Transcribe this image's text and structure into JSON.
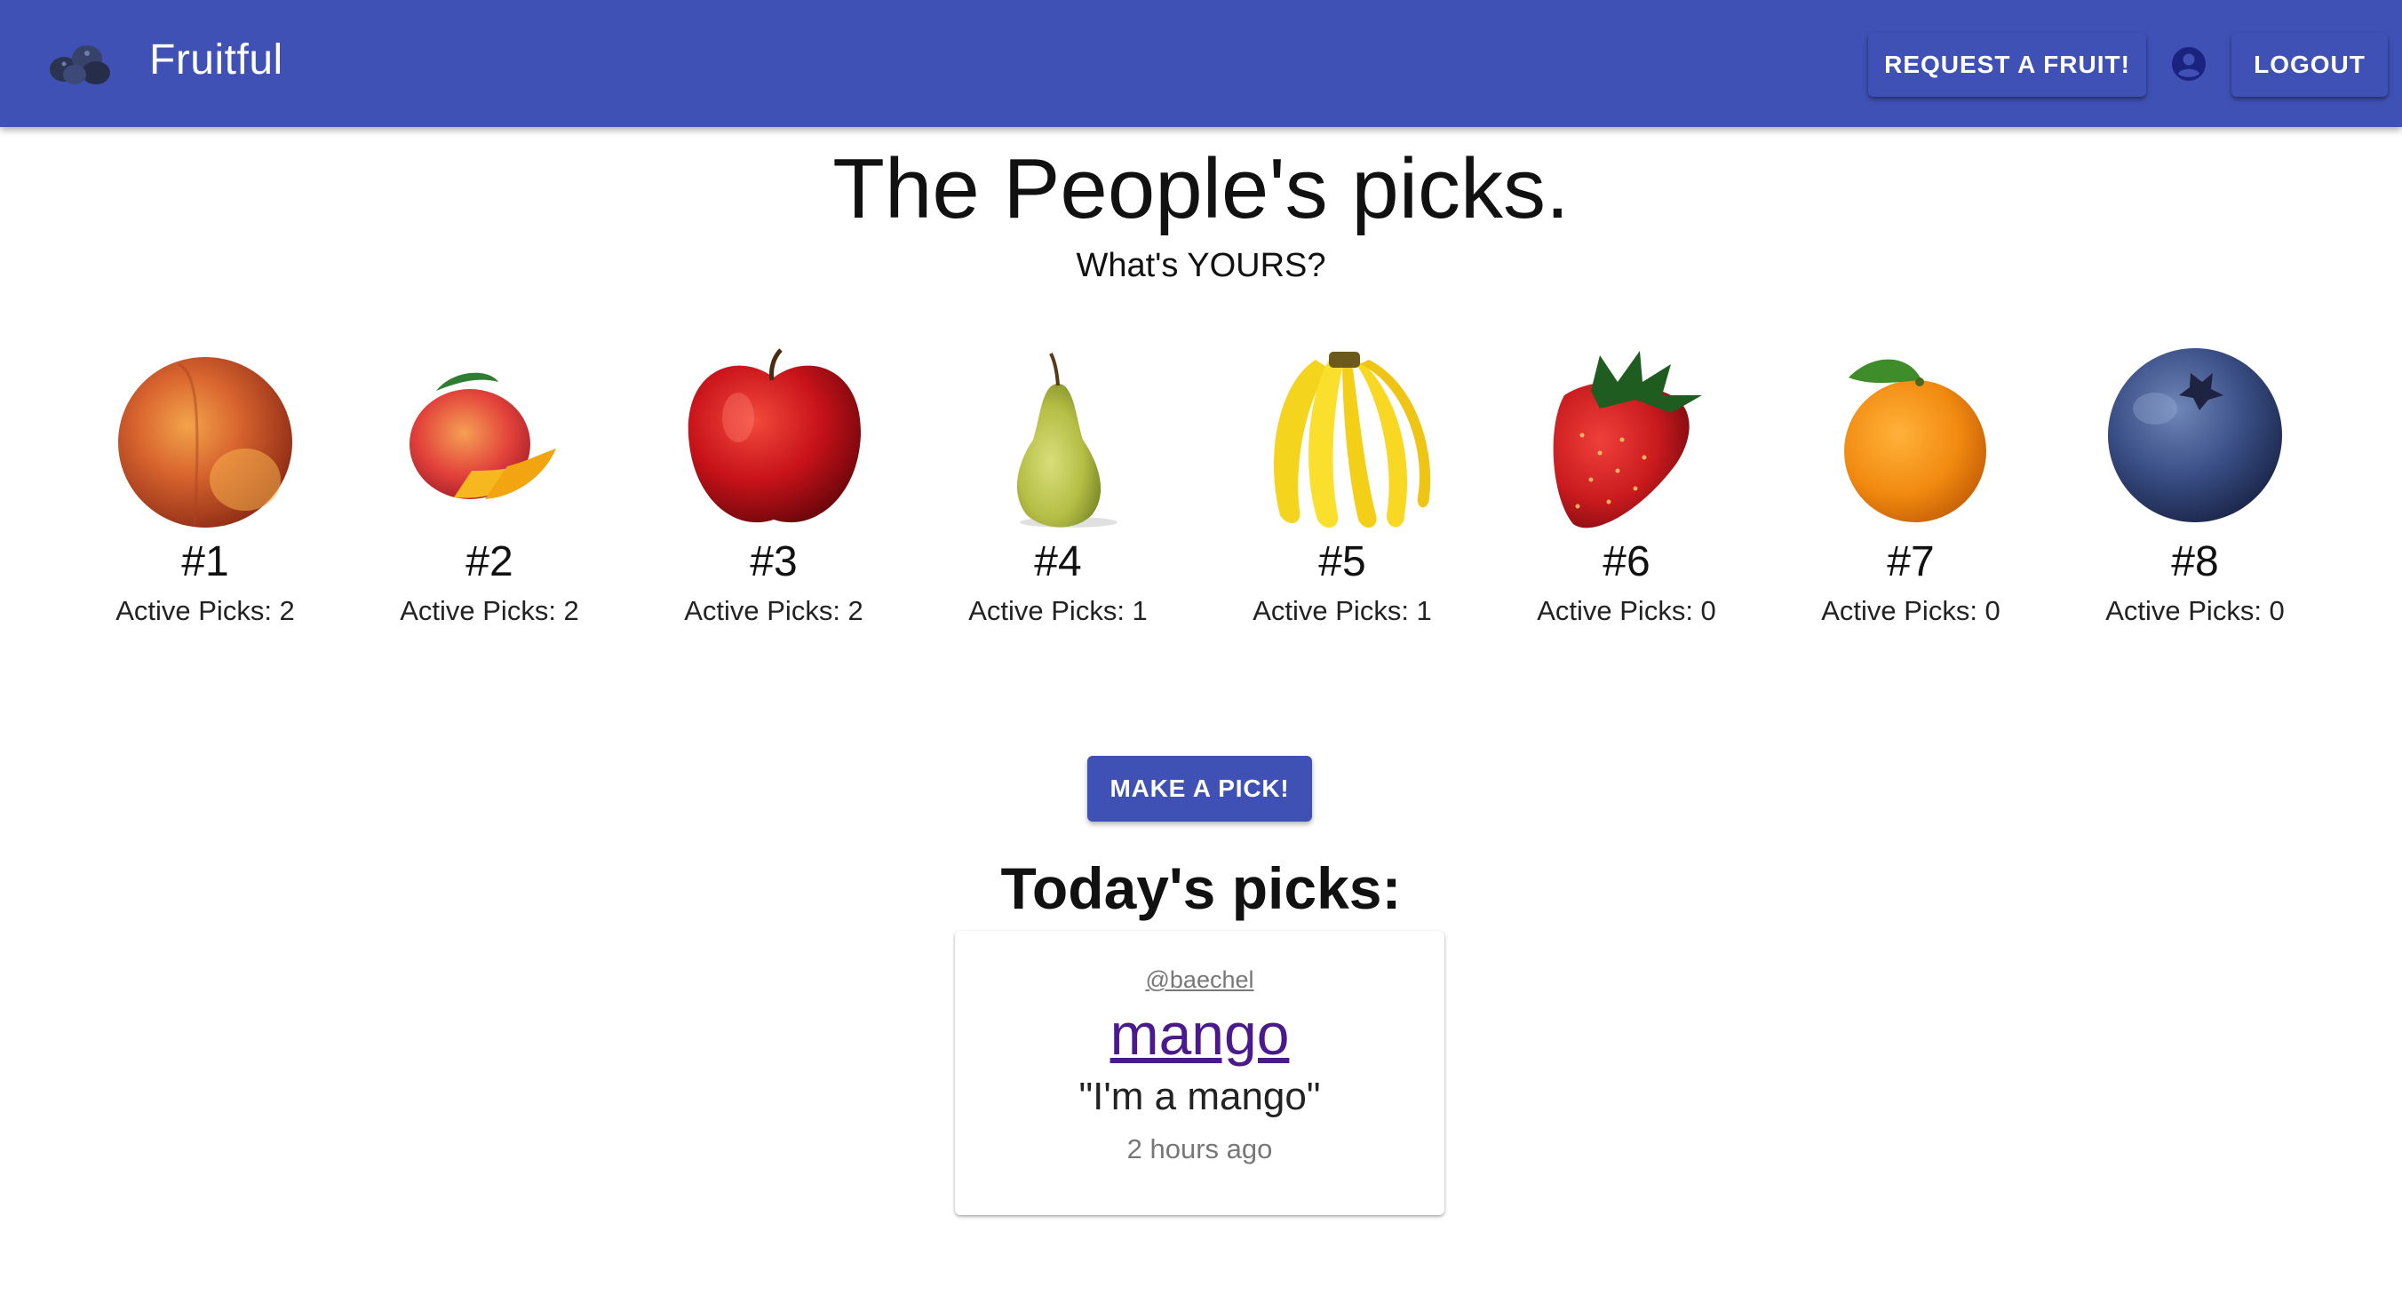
{
  "header": {
    "brand": "Fruitful",
    "logo_icon": "blueberries-logo-icon",
    "request_label": "REQUEST A FRUIT!",
    "account_icon": "account-circle-icon",
    "logout_label": "LOGOUT",
    "bar_color": "#3f51b5"
  },
  "hero": {
    "title": "The People's picks.",
    "subtitle": "What's YOURS?"
  },
  "rankings": [
    {
      "rank": "#1",
      "picks": "Active Picks: 2",
      "icon": "peach-icon"
    },
    {
      "rank": "#2",
      "picks": "Active Picks: 2",
      "icon": "mango-icon"
    },
    {
      "rank": "#3",
      "picks": "Active Picks: 2",
      "icon": "apple-icon"
    },
    {
      "rank": "#4",
      "picks": "Active Picks: 1",
      "icon": "pear-icon"
    },
    {
      "rank": "#5",
      "picks": "Active Picks: 1",
      "icon": "banana-icon"
    },
    {
      "rank": "#6",
      "picks": "Active Picks: 0",
      "icon": "strawberry-icon"
    },
    {
      "rank": "#7",
      "picks": "Active Picks: 0",
      "icon": "orange-icon"
    },
    {
      "rank": "#8",
      "picks": "Active Picks: 0",
      "icon": "blueberry-icon"
    }
  ],
  "make_pick_label": "MAKE A PICK!",
  "today": {
    "title": "Today's picks:",
    "picks": [
      {
        "user": "@baechel",
        "fruit": "mango",
        "quote": "\"I'm a mango\"",
        "time": "2 hours ago"
      }
    ]
  }
}
